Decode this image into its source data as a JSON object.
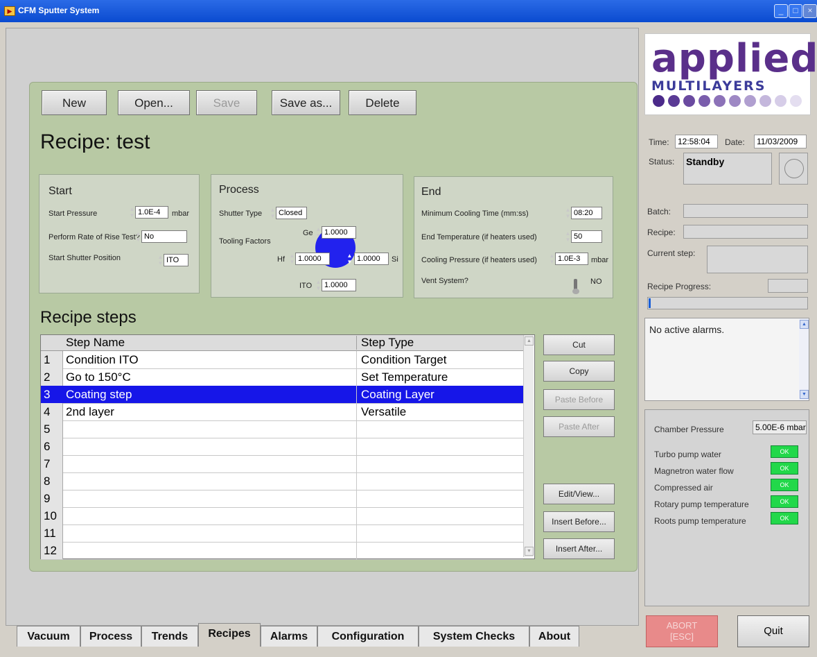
{
  "window": {
    "title": "CFM Sputter System"
  },
  "toolbar": {
    "new": "New",
    "open": "Open...",
    "save": "Save",
    "save_as": "Save as...",
    "delete": "Delete"
  },
  "recipe": {
    "title": "Recipe: test"
  },
  "start": {
    "title": "Start",
    "start_pressure_label": "Start Pressure",
    "start_pressure_value": "1.0E-4",
    "start_pressure_unit": "mbar",
    "rate_rise_label": "Perform Rate of Rise Test?",
    "rate_rise_value": "No",
    "shutter_pos_label": "Start Shutter Position",
    "shutter_pos_value": "ITO"
  },
  "process": {
    "title": "Process",
    "shutter_type_label": "Shutter Type",
    "shutter_type_value": "Closed",
    "tooling_label": "Tooling Factors",
    "ge_label": "Ge",
    "ge_value": "1.0000",
    "hf_label": "Hf",
    "hf_value": "1.0000",
    "si_label": "Si",
    "si_value": "1.0000",
    "ito_label": "ITO",
    "ito_value": "1.0000"
  },
  "end": {
    "title": "End",
    "cooling_time_label": "Minimum Cooling Time (mm:ss)",
    "cooling_time_value": "08:20",
    "end_temp_label": "End Temperature (if heaters used)",
    "end_temp_value": "50",
    "cooling_pressure_label": "Cooling Pressure (if heaters used)",
    "cooling_pressure_value": "1.0E-3",
    "cooling_pressure_unit": "mbar",
    "vent_label": "Vent System?",
    "vent_value": "NO"
  },
  "steps": {
    "title": "Recipe steps",
    "col_name": "Step Name",
    "col_type": "Step Type",
    "rows": [
      {
        "num": "1",
        "name": "Condition ITO",
        "type": "Condition Target"
      },
      {
        "num": "2",
        "name": "Go to 150°C",
        "type": "Set Temperature"
      },
      {
        "num": "3",
        "name": "Coating step",
        "type": "Coating Layer"
      },
      {
        "num": "4",
        "name": "2nd layer",
        "type": "Versatile"
      },
      {
        "num": "5",
        "name": "",
        "type": ""
      },
      {
        "num": "6",
        "name": "",
        "type": ""
      },
      {
        "num": "7",
        "name": "",
        "type": ""
      },
      {
        "num": "8",
        "name": "",
        "type": ""
      },
      {
        "num": "9",
        "name": "",
        "type": ""
      },
      {
        "num": "10",
        "name": "",
        "type": ""
      },
      {
        "num": "11",
        "name": "",
        "type": ""
      },
      {
        "num": "12",
        "name": "",
        "type": ""
      }
    ],
    "selected": "3"
  },
  "side_buttons": {
    "cut": "Cut",
    "copy": "Copy",
    "paste_before": "Paste Before",
    "paste_after": "Paste After",
    "edit_view": "Edit/View...",
    "insert_before": "Insert Before...",
    "insert_after": "Insert After..."
  },
  "tabs": [
    "Vacuum",
    "Process",
    "Trends",
    "Recipes",
    "Alarms",
    "Configuration",
    "System Checks",
    "About"
  ],
  "active_tab": "Recipes",
  "logo": {
    "name": "applied",
    "sub": "MULTILAYERS"
  },
  "status": {
    "time_label": "Time:",
    "time": "12:58:04",
    "date_label": "Date:",
    "date": "11/03/2009",
    "status_label": "Status:",
    "status": "Standby",
    "batch_label": "Batch:",
    "recipe_label": "Recipe:",
    "current_step_label": "Current step:",
    "progress_label": "Recipe Progress:",
    "progress": 0.0
  },
  "alarms": {
    "text": "No active alarms."
  },
  "checks": {
    "chamber_label": "Chamber Pressure",
    "chamber_value": "5.00E-6 mbar",
    "items": [
      {
        "label": "Turbo pump water",
        "state": "OK"
      },
      {
        "label": "Magnetron water flow",
        "state": "OK"
      },
      {
        "label": "Compressed air",
        "state": "OK"
      },
      {
        "label": "Rotary pump temperature",
        "state": "OK"
      },
      {
        "label": "Roots pump temperature",
        "state": "OK"
      }
    ]
  },
  "actions": {
    "abort": "ABORT",
    "abort_key": "[ESC]",
    "quit": "Quit"
  },
  "colors": {
    "selection": "#1616e8",
    "ok": "#22d84a",
    "panel": "#b8c9a4",
    "logo_purple": "#5a2f8a"
  }
}
